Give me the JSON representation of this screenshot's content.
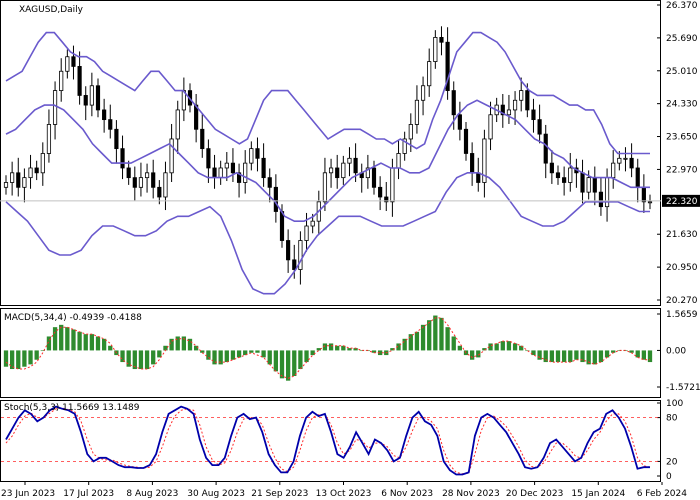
{
  "colors": {
    "background": "#ffffff",
    "text": "#000000",
    "frame": "#000000",
    "bollinger": "#6a5acd",
    "candle": "#000000",
    "up_candle": "#ffffff",
    "macd_hist": "#2e8b2e",
    "macd_signal": "#ff2a2a",
    "stoch_main": "#0000aa",
    "stoch_signal": "#ff2a2a",
    "last_price_bg": "#000000",
    "last_price_text": "#ffffff",
    "last_price_line": "#c0c0c0"
  },
  "header": {
    "symbol": "XAGUSD,Daily",
    "macd_label": "MACD(5,34,4) -0.4939 -0.4188",
    "stoch_label": "Stoch(5,3,3) 11.5669 13.1489"
  },
  "x_axis": {
    "labels": [
      "23 Jun 2023",
      "17 Jul 2023",
      "8 Aug 2023",
      "30 Aug 2023",
      "21 Sep 2023",
      "13 Oct 2023",
      "6 Nov 2023",
      "28 Nov 2023",
      "20 Dec 2023",
      "15 Jan 2024",
      "6 Feb 2024"
    ]
  },
  "chart_data": [
    {
      "type": "candlestick",
      "panel": "price",
      "symbol": "XAGUSD",
      "timeframe": "Daily",
      "y_ticks": [
        "26.370",
        "25.690",
        "25.010",
        "24.330",
        "23.650",
        "22.970",
        "21.630",
        "20.950",
        "20.270"
      ],
      "ylim": [
        20.27,
        26.37
      ],
      "last_price": "22.320",
      "close": [
        22.7,
        22.9,
        22.6,
        22.8,
        23.0,
        22.9,
        23.3,
        23.9,
        24.6,
        25.0,
        25.3,
        25.1,
        24.5,
        24.3,
        24.7,
        24.2,
        24.0,
        23.8,
        23.4,
        23.0,
        22.8,
        22.6,
        22.8,
        22.9,
        22.6,
        22.4,
        22.9,
        23.6,
        24.2,
        24.6,
        24.3,
        23.8,
        23.4,
        23.0,
        22.8,
        23.0,
        23.1,
        22.9,
        22.7,
        23.1,
        23.4,
        23.2,
        22.8,
        22.6,
        22.1,
        21.5,
        21.1,
        20.9,
        21.5,
        21.8,
        21.9,
        22.3,
        22.9,
        23.0,
        22.8,
        23.1,
        23.2,
        22.9,
        22.8,
        23.0,
        22.6,
        22.4,
        22.3,
        23.0,
        23.3,
        23.6,
        23.9,
        24.4,
        24.7,
        25.2,
        25.7,
        25.6,
        24.6,
        24.1,
        23.8,
        23.3,
        22.9,
        22.7,
        23.6,
        24.1,
        24.3,
        24.1,
        24.2,
        24.4,
        24.6,
        24.2,
        24.0,
        23.7,
        23.1,
        22.9,
        22.8,
        22.7,
        23.0,
        22.9,
        22.5,
        22.8,
        22.5,
        22.2,
        22.8,
        23.1,
        23.2,
        23.2,
        23.0,
        22.6,
        22.3,
        22.3
      ],
      "bollinger_upper": [
        24.8,
        24.9,
        25.0,
        25.3,
        25.6,
        25.8,
        25.8,
        25.6,
        25.4,
        25.3,
        25.3,
        25.2,
        25.0,
        24.9,
        24.8,
        24.7,
        24.6,
        24.8,
        25.0,
        25.0,
        24.8,
        24.6,
        24.6,
        24.4,
        24.2,
        24.0,
        23.8,
        23.7,
        23.6,
        23.5,
        23.6,
        24.0,
        24.4,
        24.6,
        24.6,
        24.6,
        24.4,
        24.2,
        24.0,
        23.8,
        23.6,
        23.7,
        23.8,
        23.8,
        23.8,
        23.7,
        23.6,
        23.6,
        23.5,
        23.6,
        23.5,
        23.4,
        23.5,
        24.0,
        24.4,
        24.9,
        25.4,
        25.6,
        25.8,
        25.8,
        25.7,
        25.6,
        25.4,
        25.1,
        24.8,
        24.6,
        24.5,
        24.5,
        24.5,
        24.4,
        24.3,
        24.3,
        24.2,
        24.2,
        23.9,
        23.5,
        23.3,
        23.3,
        23.3,
        23.3,
        23.3
      ],
      "bollinger_middle": [
        23.7,
        23.8,
        24.0,
        24.2,
        24.3,
        24.3,
        24.2,
        24.0,
        23.8,
        23.5,
        23.3,
        23.1,
        23.1,
        23.1,
        23.2,
        23.3,
        23.4,
        23.5,
        23.3,
        23.1,
        22.9,
        22.8,
        22.8,
        22.8,
        22.9,
        22.8,
        22.7,
        22.5,
        22.3,
        22.0,
        21.9,
        21.9,
        22.0,
        22.2,
        22.4,
        22.6,
        22.8,
        22.9,
        23.0,
        23.1,
        23.0,
        23.0,
        22.9,
        22.9,
        23.0,
        23.4,
        23.8,
        24.1,
        24.3,
        24.4,
        24.3,
        24.2,
        24.1,
        24.0,
        23.8,
        23.6,
        23.5,
        23.3,
        23.2,
        23.0,
        22.9,
        22.8,
        22.8,
        22.8,
        22.7,
        22.6,
        22.6,
        22.6
      ],
      "bollinger_lower": [
        22.3,
        22.1,
        21.9,
        21.6,
        21.3,
        21.2,
        21.2,
        21.3,
        21.6,
        21.8,
        21.8,
        21.7,
        21.6,
        21.6,
        21.7,
        21.9,
        22.0,
        22.0,
        22.1,
        22.2,
        22.0,
        21.5,
        20.9,
        20.5,
        20.4,
        20.4,
        20.6,
        20.9,
        21.3,
        21.6,
        21.8,
        22.0,
        22.0,
        22.0,
        21.9,
        21.8,
        21.8,
        21.8,
        21.9,
        22.0,
        22.1,
        22.5,
        22.8,
        22.9,
        22.9,
        22.8,
        22.6,
        22.3,
        22.0,
        21.9,
        21.8,
        21.8,
        21.9,
        22.1,
        22.3,
        22.3,
        22.3,
        22.3,
        22.2,
        22.1,
        22.1
      ]
    },
    {
      "type": "bar",
      "panel": "macd",
      "y_ticks": [
        "1.5659",
        "0.00",
        "-1.5721"
      ],
      "ylim": [
        -1.5721,
        1.5659
      ],
      "histogram": [
        -0.7,
        -0.8,
        -0.8,
        -0.7,
        -0.6,
        -0.4,
        0.0,
        0.6,
        1.0,
        1.1,
        1.0,
        0.9,
        0.8,
        0.7,
        0.7,
        0.6,
        0.5,
        0.2,
        -0.2,
        -0.5,
        -0.7,
        -0.8,
        -0.8,
        -0.8,
        -0.6,
        -0.3,
        0.2,
        0.5,
        0.6,
        0.6,
        0.5,
        0.2,
        -0.1,
        -0.4,
        -0.6,
        -0.6,
        -0.5,
        -0.4,
        -0.3,
        -0.2,
        -0.1,
        -0.1,
        -0.3,
        -0.6,
        -0.9,
        -1.2,
        -1.3,
        -1.1,
        -0.8,
        -0.5,
        -0.2,
        0.1,
        0.3,
        0.3,
        0.2,
        0.2,
        0.1,
        0.1,
        0.0,
        0.0,
        -0.1,
        -0.2,
        -0.2,
        0.1,
        0.3,
        0.5,
        0.7,
        0.8,
        1.1,
        1.3,
        1.5,
        1.4,
        1.0,
        0.6,
        0.2,
        -0.2,
        -0.4,
        -0.3,
        0.1,
        0.3,
        0.3,
        0.4,
        0.4,
        0.3,
        0.2,
        0.0,
        -0.2,
        -0.4,
        -0.5,
        -0.5,
        -0.5,
        -0.5,
        -0.5,
        -0.4,
        -0.5,
        -0.6,
        -0.6,
        -0.5,
        -0.3,
        -0.1,
        0.0,
        0.0,
        -0.1,
        -0.3,
        -0.4,
        -0.5
      ],
      "signal": [
        -0.5,
        -0.7,
        -0.8,
        -0.8,
        -0.7,
        -0.5,
        -0.1,
        0.4,
        0.8,
        1.0,
        1.0,
        0.9,
        0.8,
        0.7,
        0.7,
        0.6,
        0.5,
        0.3,
        -0.1,
        -0.4,
        -0.6,
        -0.7,
        -0.8,
        -0.8,
        -0.7,
        -0.4,
        0.0,
        0.4,
        0.5,
        0.5,
        0.4,
        0.2,
        -0.1,
        -0.3,
        -0.5,
        -0.5,
        -0.5,
        -0.4,
        -0.3,
        -0.2,
        -0.1,
        -0.2,
        -0.3,
        -0.6,
        -0.9,
        -1.1,
        -1.2,
        -1.1,
        -0.8,
        -0.5,
        -0.2,
        0.0,
        0.2,
        0.2,
        0.2,
        0.2,
        0.1,
        0.1,
        0.0,
        0.0,
        -0.1,
        -0.1,
        -0.1,
        0.0,
        0.2,
        0.4,
        0.6,
        0.8,
        1.0,
        1.2,
        1.4,
        1.4,
        1.1,
        0.7,
        0.3,
        -0.1,
        -0.3,
        -0.2,
        0.0,
        0.2,
        0.3,
        0.4,
        0.4,
        0.3,
        0.2,
        0.0,
        -0.2,
        -0.3,
        -0.4,
        -0.5,
        -0.5,
        -0.5,
        -0.5,
        -0.4,
        -0.4,
        -0.5,
        -0.6,
        -0.5,
        -0.3,
        -0.1,
        0.0,
        0.0,
        -0.1,
        -0.3,
        -0.4,
        -0.4
      ]
    },
    {
      "type": "line",
      "panel": "stoch",
      "y_ticks": [
        "100",
        "80",
        "20",
        "0"
      ],
      "ylim": [
        0,
        100
      ],
      "levels": [
        80,
        20
      ],
      "main": [
        50,
        65,
        80,
        90,
        85,
        75,
        80,
        90,
        95,
        92,
        90,
        85,
        60,
        30,
        20,
        25,
        25,
        20,
        15,
        12,
        12,
        11,
        11,
        15,
        30,
        60,
        85,
        90,
        95,
        92,
        85,
        50,
        25,
        15,
        15,
        25,
        55,
        80,
        85,
        78,
        80,
        60,
        30,
        15,
        5,
        5,
        20,
        55,
        80,
        88,
        82,
        85,
        60,
        30,
        25,
        40,
        60,
        45,
        30,
        50,
        45,
        35,
        20,
        25,
        55,
        80,
        88,
        75,
        70,
        55,
        20,
        8,
        2,
        2,
        5,
        55,
        80,
        85,
        80,
        70,
        60,
        45,
        30,
        12,
        10,
        12,
        25,
        45,
        50,
        40,
        30,
        20,
        25,
        45,
        60,
        65,
        85,
        90,
        80,
        65,
        40,
        10,
        12,
        12
      ],
      "signal": [
        45,
        55,
        70,
        82,
        86,
        80,
        80,
        86,
        92,
        93,
        91,
        88,
        75,
        50,
        30,
        24,
        22,
        22,
        18,
        15,
        13,
        12,
        11,
        12,
        20,
        40,
        65,
        82,
        90,
        92,
        90,
        70,
        40,
        22,
        15,
        18,
        35,
        60,
        78,
        80,
        80,
        70,
        45,
        25,
        10,
        6,
        12,
        35,
        62,
        80,
        84,
        84,
        70,
        45,
        30,
        35,
        50,
        48,
        38,
        45,
        45,
        40,
        28,
        25,
        40,
        62,
        80,
        80,
        75,
        65,
        35,
        15,
        5,
        3,
        4,
        30,
        62,
        80,
        82,
        76,
        68,
        55,
        40,
        22,
        13,
        12,
        18,
        32,
        45,
        45,
        38,
        28,
        24,
        35,
        50,
        60,
        75,
        85,
        85,
        75,
        55,
        25,
        14,
        12
      ]
    }
  ]
}
